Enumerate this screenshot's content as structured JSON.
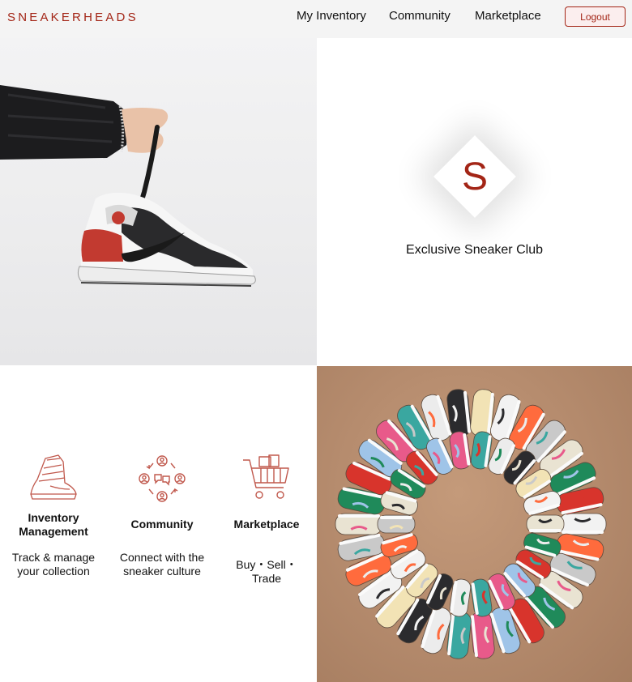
{
  "brand": "SNEAKERHEADS",
  "nav": [
    {
      "label": "My Inventory"
    },
    {
      "label": "Community"
    },
    {
      "label": "Marketplace"
    }
  ],
  "logout_label": "Logout",
  "logo": {
    "letter": "S",
    "tagline": "Exclusive Sneaker Club"
  },
  "features": [
    {
      "icon": "sneaker-icon",
      "title": "Inventory Management",
      "description": "Track & manage your collection"
    },
    {
      "icon": "community-icon",
      "title": "Community",
      "description": "Connect with the sneaker culture"
    },
    {
      "icon": "shopping-cart-icon",
      "title": "Marketplace",
      "description": "Buy・Sell・Trade"
    }
  ],
  "colors": {
    "accent": "#a32516",
    "header_bg": "#f4f4f4"
  }
}
